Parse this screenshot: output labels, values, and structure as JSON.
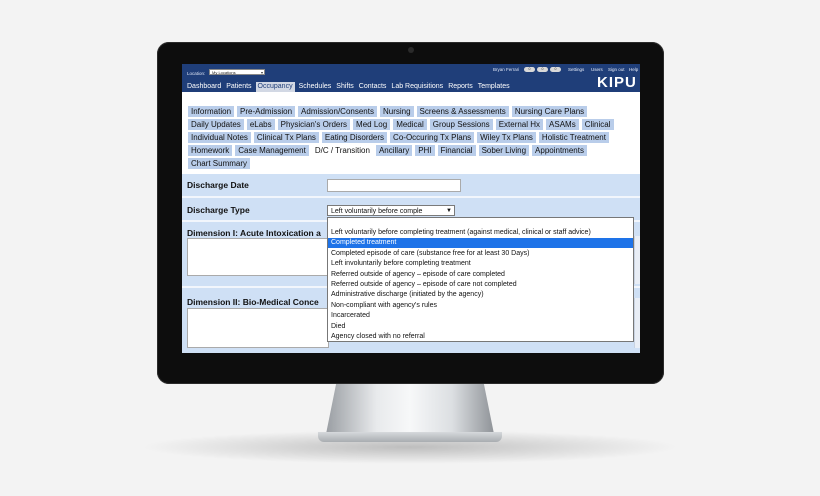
{
  "topbar": {
    "location_label": "Location:",
    "location_value": "My Locations",
    "user_name": "Bryan Ferrari",
    "pills": [
      "0",
      "0",
      "0"
    ],
    "links": [
      "Settings",
      "Users",
      "Sign out",
      "Help"
    ],
    "logo": "KIPU"
  },
  "nav": [
    "Dashboard",
    "Patients",
    "Occupancy",
    "Schedules",
    "Shifts",
    "Contacts",
    "Lab Requisitions",
    "Reports",
    "Templates"
  ],
  "nav_active": "Occupancy",
  "tabs": [
    "Information",
    "Pre-Admission",
    "Admission/Consents",
    "Nursing",
    "Screens & Assessments",
    "Nursing Care Plans",
    "Daily Updates",
    "eLabs",
    "Physician's Orders",
    "Med Log",
    "Medical",
    "Group Sessions",
    "External Hx",
    "ASAMs",
    "Clinical",
    "Individual Notes",
    "Clinical Tx Plans",
    "Eating Disorders",
    "Co-Occuring Tx Plans",
    "Wiley Tx Plans",
    "Holistic Treatment",
    "Homework",
    "Case Management",
    "D/C / Transition",
    "Ancillary",
    "PHI",
    "Financial",
    "Sober Living",
    "Appointments",
    "Chart Summary"
  ],
  "tab_active": "D/C / Transition",
  "form": {
    "discharge_date_label": "Discharge Date",
    "discharge_date_value": "",
    "discharge_type_label": "Discharge Type",
    "discharge_type_value": "Left voluntarily before comple",
    "dimension1_label": "Dimension I: Acute Intoxication a",
    "dimension2_label": "Dimension II: Bio-Medical Conce"
  },
  "dropdown_options": [
    "Left voluntarily before completing treatment (against medical, clinical or staff advice)",
    "Completed treatment",
    "Completed episode of care (substance free for at least 30 Days)",
    "Left involuntarily before completing treatment",
    "Referred outside of agency – episode of care completed",
    "Referred outside of agency – episode of care not completed",
    "Administrative discharge (initiated by the agency)",
    "Non-compliant with agency's rules",
    "Incarcerated",
    "Died",
    "Agency closed with no referral"
  ],
  "dropdown_highlighted": "Completed treatment"
}
